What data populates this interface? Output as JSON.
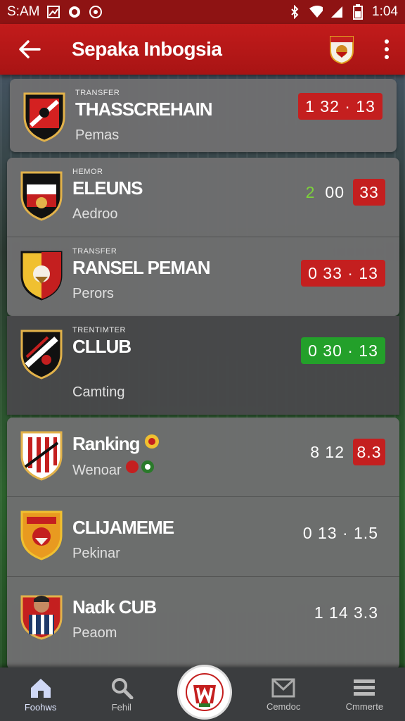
{
  "status_bar": {
    "left_text": "S:AM",
    "time": "1:04",
    "icons": [
      "photo-icon",
      "circle-app-icon",
      "settings-circle-icon",
      "bluetooth-icon",
      "wifi-icon",
      "signal-icon",
      "battery-icon"
    ]
  },
  "app_bar": {
    "title": "Sepaka Inbogsia",
    "back_icon": "arrow-left-icon",
    "menu_icon": "more-vertical-icon"
  },
  "items": [
    {
      "tag": "TRANSFER",
      "name": "THASSCREHAIN",
      "sub": "Pemas",
      "score": "1  32  ·  13",
      "score_style": "red"
    },
    {
      "tag": "HEMOR",
      "name": "ELEUNS",
      "sub": "Aedroo",
      "score_lead": "2",
      "score": "00",
      "score_badge": "33",
      "score_style": "mixed"
    },
    {
      "tag": "TRANSFER",
      "name": "RANSEL PEMAN",
      "sub": "Perors",
      "score": "0  33  ·  13",
      "score_style": "red"
    },
    {
      "tag": "TRENTIMTER",
      "name": "CLLUB",
      "sub": "Camting",
      "score": "0  30  ·  13",
      "score_style": "green"
    },
    {
      "tag": "",
      "name": "Ranking",
      "sub": "Wenoar",
      "score": "8  12",
      "score_badge": "8.3",
      "score_style": "plain-badge"
    },
    {
      "tag": "",
      "name": "CLIJAMEME",
      "sub": "Pekinar",
      "score": "0  13  ·  1.5",
      "score_style": "plain"
    },
    {
      "tag": "",
      "name": "Nadk CUB",
      "sub": "Peaom",
      "score": "1  14    3.3",
      "score_style": "plain"
    }
  ],
  "bottom_nav": [
    {
      "label": "Foohws",
      "icon": "home-icon"
    },
    {
      "label": "Fehil",
      "icon": "search-icon"
    },
    {
      "label": "",
      "icon": "center-logo-icon"
    },
    {
      "label": "Cemdoc",
      "icon": "mail-icon"
    },
    {
      "label": "Cmmerte",
      "icon": "list-icon"
    }
  ],
  "colors": {
    "brand_red": "#c21b1b",
    "badge_red": "#c41f1f",
    "badge_green": "#23a02a"
  }
}
